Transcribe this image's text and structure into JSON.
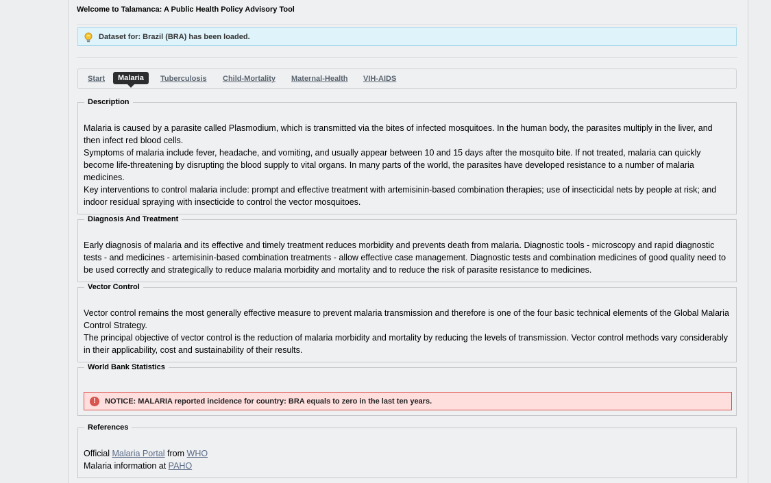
{
  "header": {
    "title": "Welcome to Talamanca: A Public Health Policy Advisory Tool"
  },
  "info_message": {
    "icon": "lightbulb-icon",
    "text": "Dataset for: Brazil (BRA) has been loaded."
  },
  "tabs": [
    {
      "label": "Start",
      "active": false
    },
    {
      "label": "Malaria",
      "active": true
    },
    {
      "label": "Tuberculosis",
      "active": false
    },
    {
      "label": "Child-Mortality",
      "active": false
    },
    {
      "label": "Maternal-Health",
      "active": false
    },
    {
      "label": "VIH-AIDS",
      "active": false
    }
  ],
  "sections": {
    "description": {
      "legend": "Description",
      "paragraphs": [
        "Malaria is caused by a parasite called Plasmodium, which is transmitted via the bites of infected mosquitoes. In the human body, the parasites multiply in the liver, and then infect red blood cells.",
        "Symptoms of malaria include fever, headache, and vomiting, and usually appear between 10 and 15 days after the mosquito bite. If not treated, malaria can quickly become life-threatening by disrupting the blood supply to vital organs. In many parts of the world, the parasites have developed resistance to a number of malaria medicines.",
        "Key interventions to control malaria include: prompt and effective treatment with artemisinin-based combination therapies; use of insecticidal nets by people at risk; and indoor residual spraying with insecticide to control the vector mosquitoes."
      ]
    },
    "diagnosis": {
      "legend": "Diagnosis And Treatment",
      "paragraphs": [
        "Early diagnosis of malaria and its effective and timely treatment reduces morbidity and prevents death from malaria. Diagnostic tools - microscopy and rapid diagnostic tests - and medicines - artemisinin-based combination treatments - allow effective case management. Diagnostic tests and combination medicines of good quality need to be used correctly and strategically to reduce malaria morbidity and mortality and to reduce the risk of parasite resistance to medicines."
      ]
    },
    "vector": {
      "legend": "Vector Control",
      "paragraphs": [
        "Vector control remains the most generally effective measure to prevent malaria transmission and therefore is one of the four basic technical elements of the Global Malaria Control Strategy.",
        "The principal objective of vector control is the reduction of malaria morbidity and mortality by reducing the levels of transmission. Vector control methods vary considerably in their applicability, cost and sustainability of their results."
      ]
    },
    "statistics": {
      "legend": "World Bank Statistics",
      "notice_icon": "error-icon",
      "notice_icon_glyph": "!",
      "notice": "NOTICE: MALARIA reported incidence for country: BRA equals to zero in the last ten years."
    },
    "references": {
      "legend": "References",
      "line1_prefix": "Official ",
      "line1_link1": "Malaria Portal",
      "line1_mid": " from ",
      "line1_link2": "WHO",
      "line2_prefix": "Malaria information at ",
      "line2_link": "PAHO"
    }
  },
  "colors": {
    "info_bg": "#def3fa",
    "notice_bg": "#ffdede",
    "notice_border": "#d9534f",
    "active_tab": "#2b2d2f",
    "link": "#5b6b86"
  }
}
